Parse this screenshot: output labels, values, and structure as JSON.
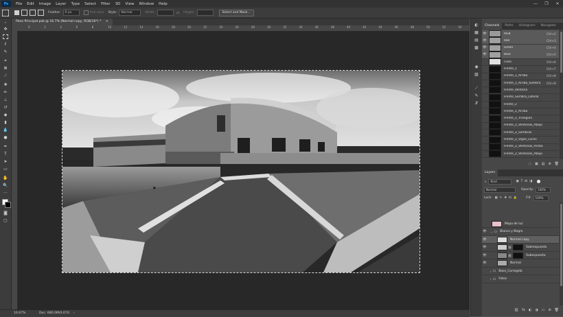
{
  "app": {
    "logo_text": "Ps",
    "menu": [
      "File",
      "Edit",
      "Image",
      "Layer",
      "Type",
      "Select",
      "Filter",
      "3D",
      "View",
      "Window",
      "Help"
    ],
    "window_controls": [
      "—",
      "❐",
      "✕"
    ]
  },
  "options_bar": {
    "feather_label": "Feather:",
    "feather_value": "0 px",
    "antialias_label": "Anti-alias",
    "style_label": "Style:",
    "style_value": "Normal",
    "width_label": "Width:",
    "height_label": "Height:",
    "select_mask_button": "Select and Mask..."
  },
  "document": {
    "tab_title": "Pano Principal.psb @ 16.7% (Normal copy, RGB/16*) *",
    "close": "×",
    "ruler_ticks": [
      "0",
      "2",
      "4",
      "6",
      "8",
      "10",
      "12",
      "14",
      "16",
      "18",
      "20",
      "22",
      "24",
      "26",
      "28",
      "30",
      "32",
      "34",
      "36",
      "38",
      "40",
      "42",
      "44",
      "46",
      "48",
      "50",
      "52",
      "54"
    ]
  },
  "status_bar": {
    "zoom": "16.67%",
    "doc_info": "Doc: 680.0M/4.67G"
  },
  "channels_panel": {
    "tabs": [
      "Channels",
      "Paths",
      "Histogram",
      "Navigator"
    ],
    "rows": [
      {
        "name": "RGB",
        "shortcut": "Ctrl+2",
        "visible": true,
        "selected": true,
        "thumb": "#9a9a9a"
      },
      {
        "name": "Red",
        "shortcut": "Ctrl+3",
        "visible": true,
        "selected": true,
        "thumb": "#a0a0a0"
      },
      {
        "name": "Green",
        "shortcut": "Ctrl+4",
        "visible": true,
        "selected": true,
        "thumb": "#a0a0a0"
      },
      {
        "name": "Blue",
        "shortcut": "Ctrl+5",
        "visible": true,
        "selected": true,
        "thumb": "#a0a0a0"
      },
      {
        "name": "Cielo",
        "shortcut": "Ctrl+6",
        "visible": false,
        "selected": false,
        "thumb": "#e0e0e0"
      },
      {
        "name": "Frente_1",
        "shortcut": "Ctrl+7",
        "visible": false,
        "selected": false,
        "thumb": "#111111"
      },
      {
        "name": "Frente_1_Arriba",
        "shortcut": "Ctrl+8",
        "visible": false,
        "selected": false,
        "thumb": "#111111"
      },
      {
        "name": "Frente_1_Arriba_Sombra",
        "shortcut": "Ctrl+9",
        "visible": false,
        "selected": false,
        "thumb": "#111111"
      },
      {
        "name": "Frente_Ventana",
        "shortcut": "",
        "visible": false,
        "selected": false,
        "thumb": "#111111"
      },
      {
        "name": "Frente_Sombra_Lateral",
        "shortcut": "",
        "visible": false,
        "selected": false,
        "thumb": "#111111"
      },
      {
        "name": "Frente_2",
        "shortcut": "",
        "visible": false,
        "selected": false,
        "thumb": "#111111"
      },
      {
        "name": "Frente_2_Arriba",
        "shortcut": "",
        "visible": false,
        "selected": false,
        "thumb": "#111111"
      },
      {
        "name": "Frente_2_Triangulo",
        "shortcut": "",
        "visible": false,
        "selected": false,
        "thumb": "#111111"
      },
      {
        "name": "Frente_2_Ventanas_Abajo",
        "shortcut": "",
        "visible": false,
        "selected": false,
        "thumb": "#111111"
      },
      {
        "name": "Frente_2_Sombras",
        "shortcut": "",
        "visible": false,
        "selected": false,
        "thumb": "#111111"
      },
      {
        "name": "Frente_2_Vigas_Luces",
        "shortcut": "",
        "visible": false,
        "selected": false,
        "thumb": "#111111"
      },
      {
        "name": "Frente_2_Ventanas_Arriba",
        "shortcut": "",
        "visible": false,
        "selected": false,
        "thumb": "#111111"
      },
      {
        "name": "Frente_2_Ventanas_Abajo",
        "shortcut": "",
        "visible": false,
        "selected": false,
        "thumb": "#111111"
      }
    ],
    "bottom_icons": [
      "◌",
      "▣",
      "▤",
      "⊕",
      "🗑"
    ]
  },
  "layers_panel": {
    "title": "Layers",
    "filter_label": "Kind",
    "blend_mode": "Normal",
    "opacity_label": "Opacity:",
    "opacity_value": "100%",
    "lock_label": "Lock:",
    "fill_label": "Fill:",
    "fill_value": "100%",
    "rows": [
      {
        "name": "Mapa de luz",
        "indent": 0,
        "visible": false,
        "type": "layer",
        "selected": false,
        "thumb": "#e8c0c8"
      },
      {
        "name": "Blanco y Negro",
        "indent": 0,
        "visible": true,
        "type": "group",
        "selected": false,
        "thumb": ""
      },
      {
        "name": "Normal copy",
        "indent": 1,
        "visible": true,
        "type": "layer",
        "selected": true,
        "thumb": "#dddddd"
      },
      {
        "name": "Sobrexpuesta",
        "indent": 1,
        "visible": true,
        "type": "masked",
        "selected": false,
        "thumb": "#cccccc"
      },
      {
        "name": "Subexpuesta",
        "indent": 1,
        "visible": true,
        "type": "masked",
        "selected": false,
        "thumb": "#888888"
      },
      {
        "name": "Normal",
        "indent": 1,
        "visible": true,
        "type": "layer",
        "selected": false,
        "thumb": "#aaaaaa"
      },
      {
        "name": "Base_Corregida",
        "indent": 0,
        "visible": false,
        "type": "group",
        "selected": false,
        "thumb": ""
      },
      {
        "name": "Fotos",
        "indent": 0,
        "visible": false,
        "type": "group",
        "selected": false,
        "thumb": ""
      }
    ],
    "bottom_icons": [
      "⛓",
      "fx",
      "◐",
      "◑",
      "▭",
      "⊕",
      "🗑"
    ]
  }
}
